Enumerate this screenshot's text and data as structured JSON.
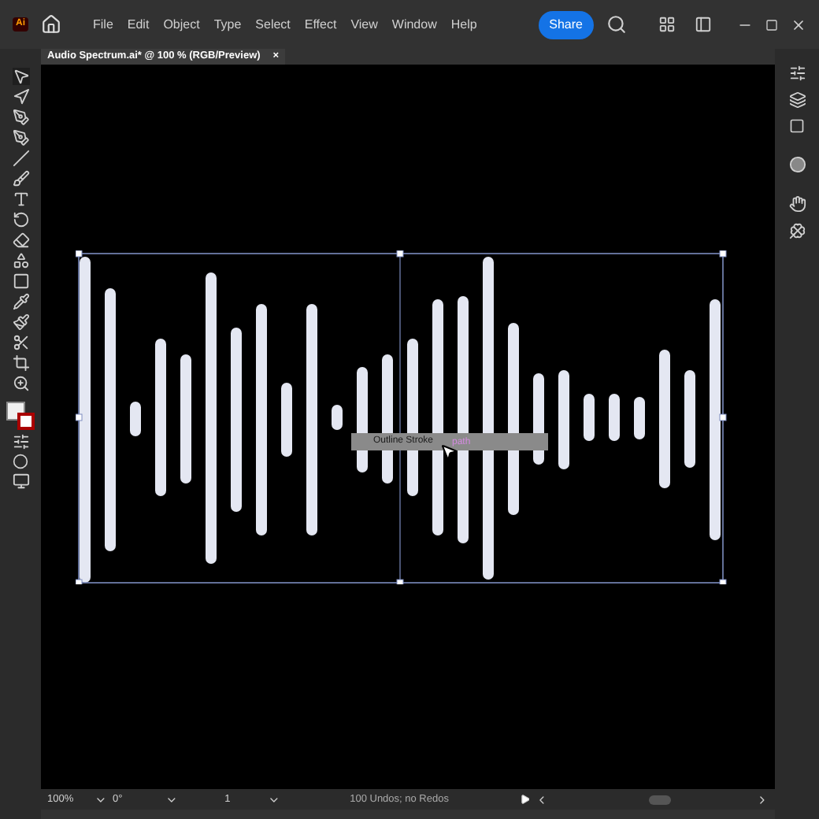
{
  "app_logo": "Ai",
  "menu": [
    "File",
    "Edit",
    "Object",
    "Type",
    "Select",
    "Effect",
    "View",
    "Window",
    "Help"
  ],
  "share_button": "Share",
  "document_tab": {
    "title": "Audio Spectrum.ai* @ 100 % (RGB/Preview)",
    "close": "×"
  },
  "canvas": {
    "tooltip": "Outline Stroke",
    "hint": "path"
  },
  "status_bar": {
    "zoom": "100%",
    "rotation": "0°",
    "artboard": "1",
    "message": "100 Undos; no Redos"
  }
}
